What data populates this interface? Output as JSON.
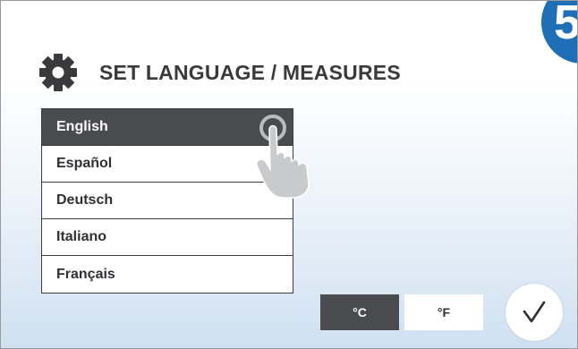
{
  "step_badge": "5",
  "header": {
    "title": "SET LANGUAGE / MEASURES",
    "icon": "gear-icon"
  },
  "languages": [
    {
      "label": "English",
      "selected": true
    },
    {
      "label": "Español",
      "selected": false
    },
    {
      "label": "Deutsch",
      "selected": false
    },
    {
      "label": "Italiano",
      "selected": false
    },
    {
      "label": "Français",
      "selected": false
    }
  ],
  "units": {
    "celsius": "°C",
    "fahrenheit": "°F",
    "selected": "celsius"
  },
  "confirm": {
    "icon": "checkmark-icon"
  },
  "colors": {
    "selected_bg": "#4a4b4f",
    "text_dark": "#3a3a3c",
    "badge_blue": "#1f6fb8",
    "gradient_bottom": "#cfe0f1"
  }
}
